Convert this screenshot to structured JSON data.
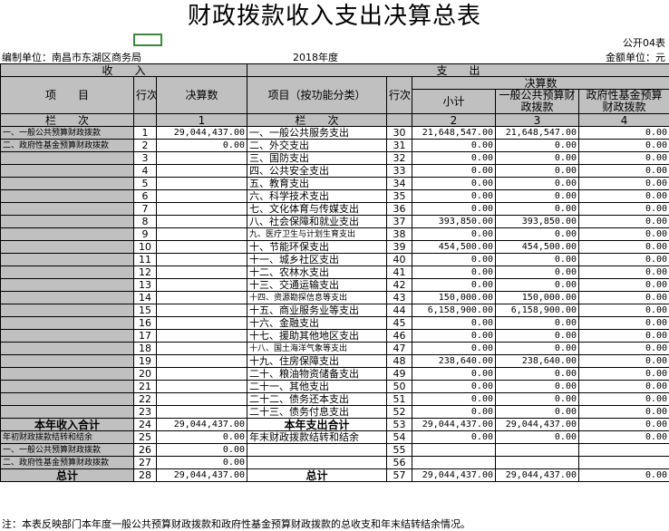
{
  "title": "财政拨款收入支出决算总表",
  "form_no": "公开04表",
  "unit": "编制单位：南昌市东湖区商务局",
  "year": "2018年度",
  "currency": "金额单位：元",
  "headers": {
    "income": "收　　入",
    "expense": "支　　出",
    "item": "项　　目",
    "row_no": "行次",
    "amount": "决算数",
    "func_item": "项目（按功能分类）",
    "final": "决算数",
    "subtotal": "小计",
    "general": "一般公共预算财政拨款",
    "gov_fund": "政府性基金预算财政拨款",
    "col_label": "栏　　次",
    "col1": "1",
    "col2": "2",
    "col3": "3",
    "col4": "4"
  },
  "rows": [
    {
      "left": "一、一般公共预算财政拨款",
      "ln": "1",
      "la": "29,044,437.00",
      "right": "一、一般公共服务支出",
      "rn": "30",
      "c2": "21,648,547.00",
      "c3": "21,648,547.00",
      "c4": "0.00"
    },
    {
      "left": "二、政府性基金预算财政拨款",
      "ln": "2",
      "la": "0.00",
      "right": "二、外交支出",
      "rn": "31",
      "c2": "0.00",
      "c3": "0.00",
      "c4": "0.00"
    },
    {
      "left": "",
      "ln": "3",
      "la": "",
      "right": "三、国防支出",
      "rn": "32",
      "c2": "0.00",
      "c3": "0.00",
      "c4": "0.00"
    },
    {
      "left": "",
      "ln": "4",
      "la": "",
      "right": "四、公共安全支出",
      "rn": "33",
      "c2": "0.00",
      "c3": "0.00",
      "c4": "0.00"
    },
    {
      "left": "",
      "ln": "5",
      "la": "",
      "right": "五、教育支出",
      "rn": "34",
      "c2": "0.00",
      "c3": "0.00",
      "c4": "0.00"
    },
    {
      "left": "",
      "ln": "6",
      "la": "",
      "right": "六、科学技术支出",
      "rn": "35",
      "c2": "0.00",
      "c3": "0.00",
      "c4": "0.00"
    },
    {
      "left": "",
      "ln": "7",
      "la": "",
      "right": "七、文化体育与传媒支出",
      "rn": "36",
      "c2": "0.00",
      "c3": "0.00",
      "c4": "0.00"
    },
    {
      "left": "",
      "ln": "8",
      "la": "",
      "right": "八、社会保障和就业支出",
      "rn": "37",
      "c2": "393,850.00",
      "c3": "393,850.00",
      "c4": "0.00"
    },
    {
      "left": "",
      "ln": "9",
      "la": "",
      "right": "九、医疗卫生与计划生育支出",
      "rn": "38",
      "c2": "0.00",
      "c3": "0.00",
      "c4": "0.00"
    },
    {
      "left": "",
      "ln": "10",
      "la": "",
      "right": "十、节能环保支出",
      "rn": "39",
      "c2": "454,500.00",
      "c3": "454,500.00",
      "c4": "0.00"
    },
    {
      "left": "",
      "ln": "11",
      "la": "",
      "right": "十一、城乡社区支出",
      "rn": "40",
      "c2": "0.00",
      "c3": "0.00",
      "c4": "0.00"
    },
    {
      "left": "",
      "ln": "12",
      "la": "",
      "right": "十二、农林水支出",
      "rn": "41",
      "c2": "0.00",
      "c3": "0.00",
      "c4": "0.00"
    },
    {
      "left": "",
      "ln": "13",
      "la": "",
      "right": "十三、交通运输支出",
      "rn": "42",
      "c2": "0.00",
      "c3": "0.00",
      "c4": "0.00"
    },
    {
      "left": "",
      "ln": "14",
      "la": "",
      "right": "十四、资源勘探信息等支出",
      "rn": "43",
      "c2": "150,000.00",
      "c3": "150,000.00",
      "c4": "0.00"
    },
    {
      "left": "",
      "ln": "15",
      "la": "",
      "right": "十五、商业服务业等支出",
      "rn": "44",
      "c2": "6,158,900.00",
      "c3": "6,158,900.00",
      "c4": "0.00"
    },
    {
      "left": "",
      "ln": "16",
      "la": "",
      "right": "十六、金融支出",
      "rn": "45",
      "c2": "0.00",
      "c3": "0.00",
      "c4": "0.00"
    },
    {
      "left": "",
      "ln": "17",
      "la": "",
      "right": "十七、援助其他地区支出",
      "rn": "46",
      "c2": "0.00",
      "c3": "0.00",
      "c4": "0.00"
    },
    {
      "left": "",
      "ln": "18",
      "la": "",
      "right": "十八、国土海洋气象等支出",
      "rn": "47",
      "c2": "0.00",
      "c3": "0.00",
      "c4": "0.00"
    },
    {
      "left": "",
      "ln": "19",
      "la": "",
      "right": "十九、住房保障支出",
      "rn": "48",
      "c2": "238,640.00",
      "c3": "238,640.00",
      "c4": "0.00"
    },
    {
      "left": "",
      "ln": "20",
      "la": "",
      "right": "二十、粮油物资储备支出",
      "rn": "49",
      "c2": "0.00",
      "c3": "0.00",
      "c4": "0.00"
    },
    {
      "left": "",
      "ln": "21",
      "la": "",
      "right": "二十一、其他支出",
      "rn": "50",
      "c2": "0.00",
      "c3": "0.00",
      "c4": "0.00"
    },
    {
      "left": "",
      "ln": "22",
      "la": "",
      "right": "二十二、债务还本支出",
      "rn": "51",
      "c2": "0.00",
      "c3": "0.00",
      "c4": "0.00"
    },
    {
      "left": "",
      "ln": "23",
      "la": "",
      "right": "二十三、债务付息支出",
      "rn": "52",
      "c2": "0.00",
      "c3": "0.00",
      "c4": "0.00"
    }
  ],
  "bottom": [
    {
      "left": "本年收入合计",
      "ln": "24",
      "la": "29,044,437.00",
      "right": "本年支出合计",
      "rn": "53",
      "c2": "29,044,437.00",
      "c3": "29,044,437.00",
      "c4": "0.00",
      "bold": true
    },
    {
      "left": "年初财政拨款结转和结余",
      "ln": "25",
      "la": "0.00",
      "right": "年末财政拨款结转和结余",
      "rn": "54",
      "c2": "0.00",
      "c3": "0.00",
      "c4": "0.00"
    },
    {
      "left": "一、一般公共预算财政拨款",
      "ln": "26",
      "la": "0.00",
      "right": "",
      "rn": "55",
      "c2": "",
      "c3": "",
      "c4": ""
    },
    {
      "left": "二、政府性基金预算财政拨款",
      "ln": "27",
      "la": "0.00",
      "right": "",
      "rn": "56",
      "c2": "",
      "c3": "",
      "c4": ""
    },
    {
      "left": "总计",
      "ln": "28",
      "la": "29,044,437.00",
      "right": "总计",
      "rn": "57",
      "c2": "29,044,437.00",
      "c3": "29,044,437.00",
      "c4": "0.00",
      "bold": true
    }
  ],
  "note": "注：本表反映部门本年度一般公共预算财政拨款和政府性基金预算财政拨款的总收支和年末结转结余情况。"
}
